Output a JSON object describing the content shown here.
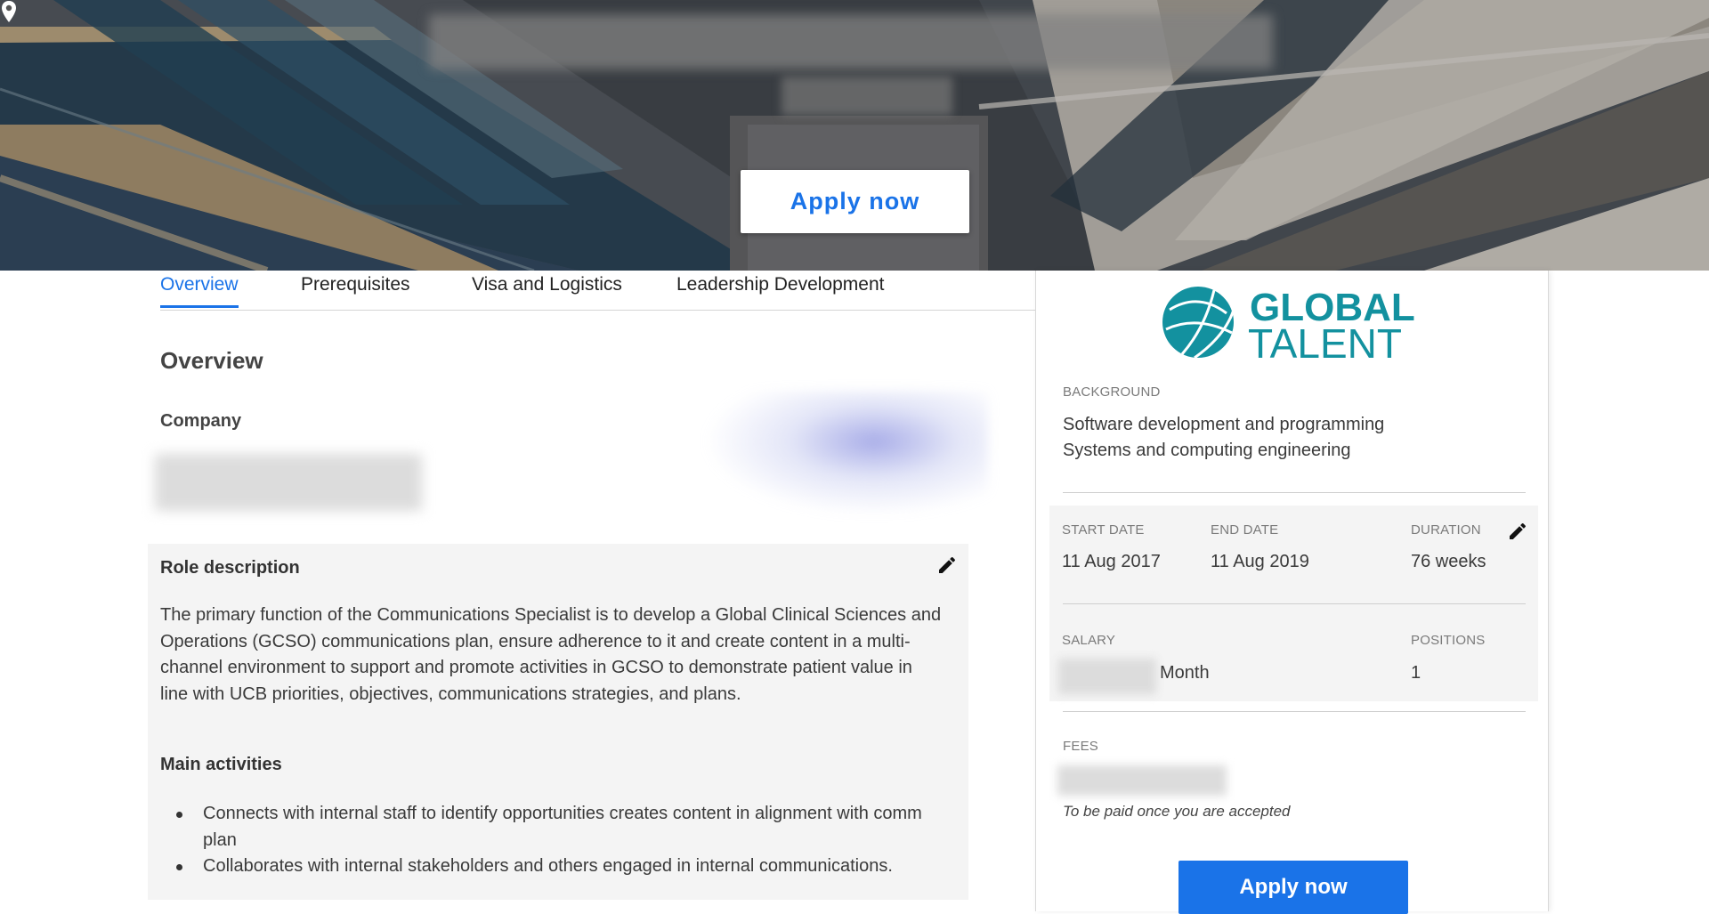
{
  "hero": {
    "apply_label": "Apply now"
  },
  "tabs": [
    {
      "label": "Overview"
    },
    {
      "label": "Prerequisites"
    },
    {
      "label": "Visa and Logistics"
    },
    {
      "label": "Leadership Development"
    }
  ],
  "overview": {
    "heading": "Overview",
    "company_label": "Company",
    "role_title": "Role description",
    "role_description": "The primary function of the Communications Specialist is to develop a Global Clinical Sciences and Operations (GCSO) communications plan, ensure adherence to it and create content in a multi-channel environment to support and promote activities in GCSO to demonstrate patient value in line with UCB priorities, objectives, communications strategies, and plans.",
    "main_activities_title": "Main activities",
    "activities": [
      "Connects with internal staff to identify opportunities creates content in alignment with comm plan",
      "Collaborates with internal stakeholders and others engaged in internal communications."
    ]
  },
  "sidebar": {
    "logo_line1": "GLOBAL",
    "logo_line2": "TALENT",
    "brand_color": "#13919f",
    "background_label": "BACKGROUND",
    "background_values": [
      "Software development and programming",
      "Systems and computing engineering"
    ],
    "start_date_label": "START DATE",
    "start_date": "11 Aug 2017",
    "end_date_label": "END DATE",
    "end_date": "11 Aug 2019",
    "duration_label": "DURATION",
    "duration": "76 weeks",
    "salary_label": "SALARY",
    "salary_unit": "Month",
    "positions_label": "POSITIONS",
    "positions": "1",
    "fees_label": "FEES",
    "fees_note": "To be paid once you are accepted",
    "apply_label": "Apply now"
  },
  "icons": {
    "location": "location-pin-icon",
    "edit": "pencil-icon"
  },
  "colors": {
    "accent": "#1a73e8",
    "panel_bg": "#f4f4f4"
  }
}
